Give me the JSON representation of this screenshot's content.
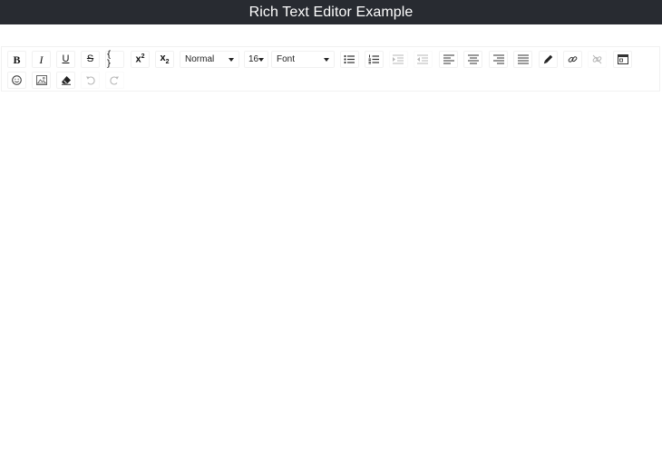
{
  "header": {
    "title": "Rich Text Editor Example"
  },
  "toolbar": {
    "bold": "B",
    "italic": "I",
    "underline": "U",
    "strikethrough": "S",
    "code": "{ }",
    "superscript_base": "x",
    "superscript_mark": "2",
    "subscript_base": "x",
    "subscript_mark": "2",
    "block_type": "Normal",
    "font_size": "16",
    "font_family": "Font"
  },
  "icons": [
    "bold-icon",
    "italic-icon",
    "underline-icon",
    "strikethrough-icon",
    "code-icon",
    "superscript-icon",
    "subscript-icon",
    "unordered-list-icon",
    "ordered-list-icon",
    "indent-icon",
    "outdent-icon",
    "align-left-icon",
    "align-center-icon",
    "align-right-icon",
    "align-justify-icon",
    "color-picker-icon",
    "link-icon",
    "unlink-icon",
    "embed-icon",
    "emoji-icon",
    "image-icon",
    "eraser-icon",
    "undo-icon",
    "redo-icon"
  ]
}
